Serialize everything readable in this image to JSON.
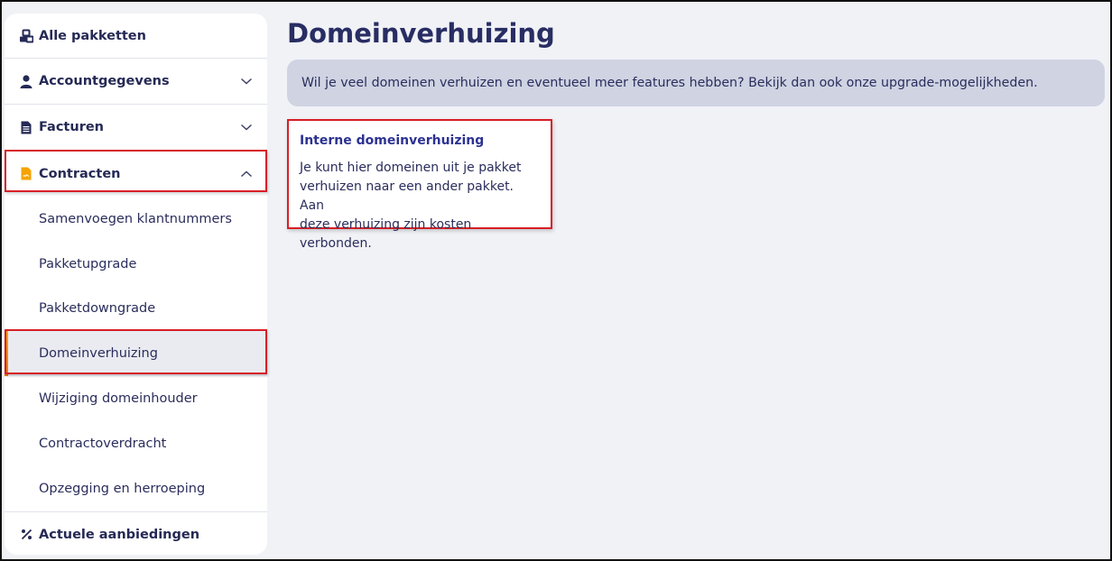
{
  "sidebar": {
    "all_packages": "Alle pakketten",
    "sections": [
      {
        "label": "Accountgegevens",
        "icon": "user-icon",
        "expanded": false
      },
      {
        "label": "Facturen",
        "icon": "invoice-icon",
        "expanded": false
      },
      {
        "label": "Contracten",
        "icon": "contract-icon",
        "expanded": true
      }
    ],
    "contract_items": [
      "Samenvoegen klantnummers",
      "Pakketupgrade",
      "Pakketdowngrade",
      "Domeinverhuizing",
      "Wijziging domeinhouder",
      "Contractoverdracht",
      "Opzegging en herroeping"
    ],
    "active_item": "Domeinverhuizing",
    "offers": "Actuele aanbiedingen"
  },
  "main": {
    "title": "Domeinverhuizing",
    "banner": "Wil je veel domeinen verhuizen en eventueel meer features hebben? Bekijk dan ook onze upgrade-mogelijkheden.",
    "card": {
      "title": "Interne domeinverhuizing",
      "line1": "Je kunt hier domeinen uit je pakket",
      "line2": "verhuizen naar een ander pakket. Aan",
      "line3": "deze verhuizing zijn kosten verbonden."
    }
  },
  "colors": {
    "accent_orange": "#f5a300",
    "navy": "#282d63",
    "highlight_red": "#d81f26",
    "banner_bg": "#cfd3e2"
  }
}
